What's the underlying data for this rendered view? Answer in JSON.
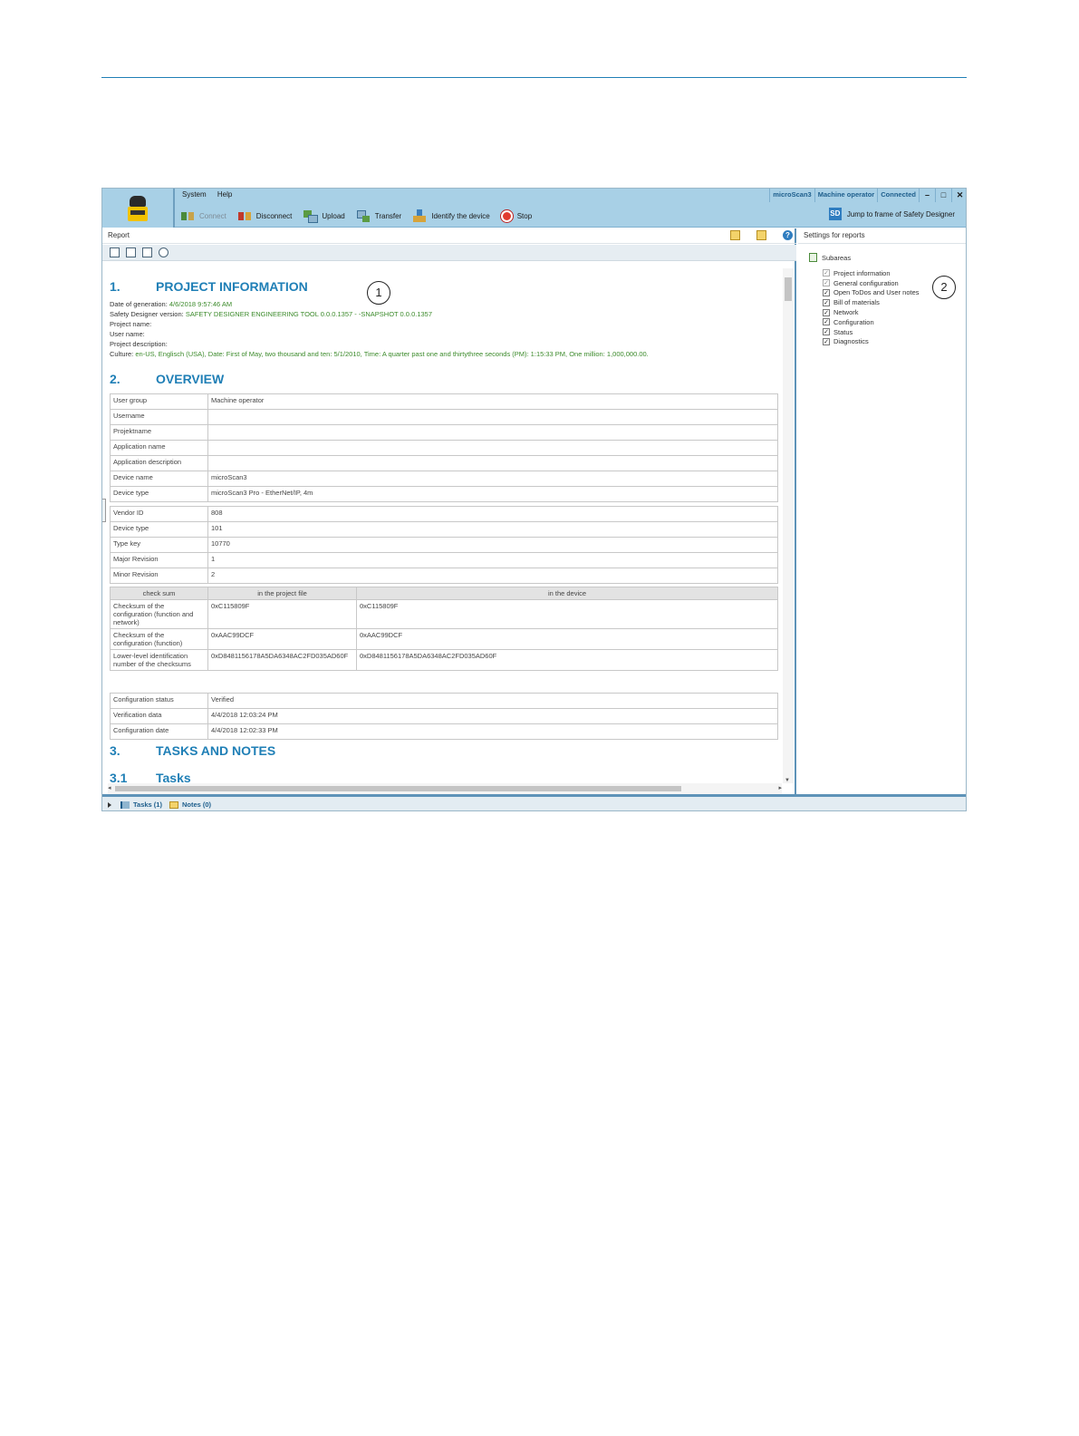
{
  "menu": {
    "system": "System",
    "help": "Help"
  },
  "status": {
    "device": "microScan3",
    "user": "Machine operator",
    "connection": "Connected"
  },
  "window_controls": {
    "minimize": "–",
    "maximize": "□",
    "close": "✕"
  },
  "toolbar": {
    "connect": "Connect",
    "disconnect": "Disconnect",
    "upload": "Upload",
    "transfer": "Transfer",
    "identify": "Identify the device",
    "stop": "Stop",
    "jump_badge": "SD",
    "jump": "Jump to frame of Safety Designer"
  },
  "report": {
    "title": "Report",
    "section1": {
      "num": "1.",
      "title": "PROJECT INFORMATION"
    },
    "meta": {
      "date_label": "Date of generation:",
      "date_value": "4/6/2018 9:57:46 AM",
      "version_label": "Safety Designer version:",
      "version_value": "SAFETY DESIGNER ENGINEERING TOOL 0.0.0.1357 - -SNAPSHOT 0.0.0.1357",
      "project_name": "Project name:",
      "user_name": "User name:",
      "project_description": "Project description:",
      "culture_label": "Culture:",
      "culture_value": "en-US, Englisch (USA), Date: First of May, two thousand and ten: 5/1/2010, Time: A quarter past one and thirtythree seconds (PM): 1:15:33 PM, One million: 1,000,000.00."
    },
    "section2": {
      "num": "2.",
      "title": "OVERVIEW"
    },
    "overview": [
      {
        "k": "User group",
        "v": "Machine operator"
      },
      {
        "k": "Username",
        "v": ""
      },
      {
        "k": "Projektname",
        "v": ""
      },
      {
        "k": "Application name",
        "v": ""
      },
      {
        "k": "Application description",
        "v": ""
      },
      {
        "k": "Device name",
        "v": "microScan3"
      },
      {
        "k": "Device type",
        "v": "microScan3 Pro - EtherNet/IP, 4m"
      }
    ],
    "ids": [
      {
        "k": "Vendor ID",
        "v": "808"
      },
      {
        "k": "Device type",
        "v": "101"
      },
      {
        "k": "Type key",
        "v": "10770"
      },
      {
        "k": "Major Revision",
        "v": "1"
      },
      {
        "k": "Minor Revision",
        "v": "2"
      }
    ],
    "checksum_headers": [
      "check sum",
      "in the project file",
      "in the device"
    ],
    "checksums": [
      {
        "k": "Checksum of the configuration (function and network)",
        "file": "0xC115809F",
        "device": "0xC115809F"
      },
      {
        "k": "Checksum of the configuration (function)",
        "file": "0xAAC99DCF",
        "device": "0xAAC99DCF"
      },
      {
        "k": "Lower-level identification number of the checksums",
        "file": "0xD8481156178A5DA6348AC2FD035AD60F",
        "device": "0xD8481156178A5DA6348AC2FD035AD60F"
      }
    ],
    "config": [
      {
        "k": "Configuration status",
        "v": "Verified"
      },
      {
        "k": "Verification data",
        "v": "4/4/2018 12:03:24 PM"
      },
      {
        "k": "Configuration date",
        "v": "4/4/2018 12:02:33 PM"
      }
    ],
    "section3": {
      "num": "3.",
      "title": "TASKS AND NOTES"
    },
    "section31": {
      "num": "3.1",
      "title": "Tasks"
    }
  },
  "settings": {
    "title": "Settings for reports",
    "subareas": "Subareas",
    "items": [
      {
        "label": "Project information",
        "checked": true,
        "dim": true
      },
      {
        "label": "General configuration",
        "checked": true,
        "dim": true
      },
      {
        "label": "Open ToDos and User notes",
        "checked": true,
        "dim": false
      },
      {
        "label": "Bill of materials",
        "checked": true,
        "dim": false
      },
      {
        "label": "Network",
        "checked": true,
        "dim": false
      },
      {
        "label": "Configuration",
        "checked": true,
        "dim": false
      },
      {
        "label": "Status",
        "checked": true,
        "dim": false
      },
      {
        "label": "Diagnostics",
        "checked": true,
        "dim": false
      }
    ]
  },
  "bottom": {
    "tasks": "Tasks (1)",
    "notes": "Notes (0)"
  },
  "callouts": {
    "one": "1",
    "two": "2"
  }
}
